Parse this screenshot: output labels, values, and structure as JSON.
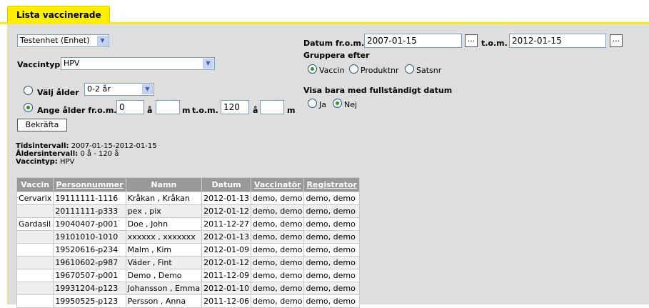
{
  "tab": {
    "title": "Lista vaccinerade"
  },
  "unit_select": {
    "value": "Testenhet (Enhet)"
  },
  "vaccintyp": {
    "label": "Vaccintyp",
    "value": "HPV"
  },
  "age": {
    "select_label": "Välj ålder",
    "select_value": "0-2 år",
    "range_label": "Ange ålder fr.o.m.",
    "from_years": "0",
    "unit_a": "å",
    "from_months": "",
    "unit_m": "m",
    "to_label": "t.o.m.",
    "to_years": "120",
    "to_months": ""
  },
  "confirm_button": "Bekräfta",
  "date": {
    "from_label": "Datum fr.o.m.",
    "from_value": "2007-01-15",
    "to_label": "t.o.m.",
    "to_value": "2012-01-15",
    "picker_label": "..."
  },
  "group_by": {
    "label": "Gruppera efter",
    "options": [
      "Vaccin",
      "Produktnr",
      "Satsnr"
    ],
    "selected": "Vaccin"
  },
  "complete_date": {
    "label": "Visa bara med fullständigt datum",
    "options": [
      "Ja",
      "Nej"
    ],
    "selected": "Nej"
  },
  "summary": {
    "time_label": "Tidsintervall:",
    "time_value": "2007-01-15-2012-01-15",
    "age_label": "Åldersintervall:",
    "age_value": "0 å - 120 å",
    "type_label": "Vaccintyp:",
    "type_value": "HPV"
  },
  "table": {
    "headers": [
      "Vaccin",
      "Personnummer",
      "Namn",
      "Datum",
      "Vaccinatör",
      "Registrator"
    ],
    "rows": [
      [
        "Cervarix",
        "19111111-1116",
        "Kråkan , Kråkan",
        "2012-01-13",
        "demo, demo",
        "demo, demo"
      ],
      [
        "",
        "20111111-p333",
        "pex , pix",
        "2012-01-12",
        "demo, demo",
        "demo, demo"
      ],
      [
        "Gardasil",
        "19040407-p001",
        "Doe , John",
        "2011-12-27",
        "demo, demo",
        "demo, demo"
      ],
      [
        "",
        "19101010-1010",
        "xxxxxx , xxxxxxx",
        "2012-01-13",
        "demo, demo",
        "demo, demo"
      ],
      [
        "",
        "19520616-p234",
        "Malm , Kim",
        "2012-01-09",
        "demo, demo",
        "demo, demo"
      ],
      [
        "",
        "19610602-p987",
        "Väder , Fint",
        "2012-01-12",
        "demo, demo",
        "demo, demo"
      ],
      [
        "",
        "19670507-p001",
        "Demo , Demo",
        "2011-12-09",
        "demo, demo",
        "demo, demo"
      ],
      [
        "",
        "19931204-p123",
        "Johansson , Emma",
        "2012-01-10",
        "demo, demo",
        "demo, demo"
      ],
      [
        "",
        "19950525-p123",
        "Persson , Anna",
        "2011-12-06",
        "demo, demo",
        "demo, demo"
      ]
    ]
  }
}
